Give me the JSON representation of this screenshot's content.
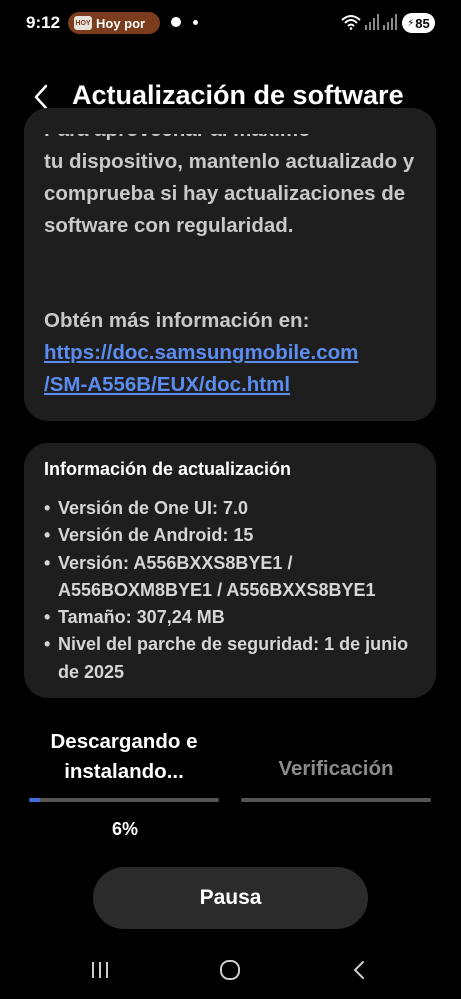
{
  "status_bar": {
    "time": "9:12",
    "notification": "Hoy por",
    "notification_logo": "HOY",
    "battery": "85",
    "icons": [
      "wifi-icon",
      "signal-icon",
      "battery-charging-icon"
    ]
  },
  "header": {
    "title": "Actualización de software",
    "back_icon": "chevron-left-icon"
  },
  "description_card": {
    "cut_line": "Para aprovechar al máximo",
    "paragraph": "tu dispositivo, mantenlo actualizado y comprueba si hay actualizaciones de software con regularidad.",
    "more_info_label": "Obtén más información en:",
    "link_line1": "https://doc.samsungmobile.com",
    "link_line2": "/SM-A556B/EUX/doc.html"
  },
  "update_info": {
    "title": "Información de actualización",
    "items": [
      "Versión de One UI: 7.0",
      "Versión de Android: 15",
      "Versión: A556BXXS8BYE1 / A556BOXM8BYE1 / A556BXXS8BYE1",
      "Tamaño: 307,24 MB",
      "Nivel del parche de seguridad: 1 de junio de 2025"
    ]
  },
  "progress": {
    "step1_label": "Descargando e instalando...",
    "step2_label": "Verificación",
    "percent_label": "6%",
    "fraction": 0.06,
    "accent_color": "#3f6fd8"
  },
  "actions": {
    "pause_label": "Pausa"
  },
  "navigation": {
    "recents_icon": "recents-icon",
    "home_icon": "home-icon",
    "back_icon": "back-icon"
  }
}
